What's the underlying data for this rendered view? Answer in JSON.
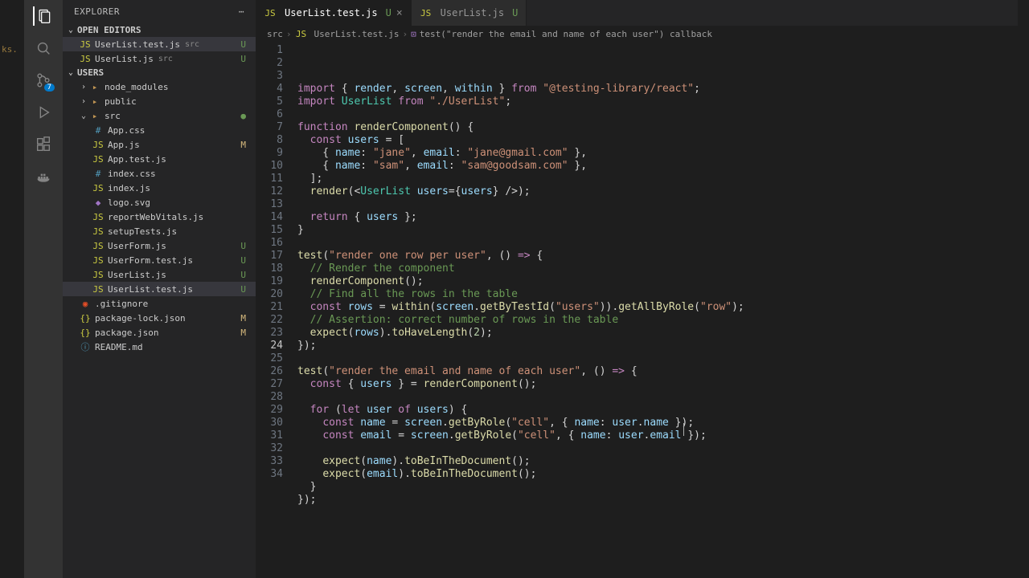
{
  "leftStrip": "ks.",
  "sidebar": {
    "title": "EXPLORER",
    "sections": {
      "openEditors": "OPEN EDITORS",
      "workspace": "USERS"
    },
    "openEditorItems": [
      {
        "name": "UserList.test.js",
        "dir": "src",
        "badge": "U"
      },
      {
        "name": "UserList.js",
        "dir": "src",
        "badge": "U"
      }
    ],
    "tree": [
      {
        "type": "folder",
        "name": "node_modules",
        "indent": 1,
        "chev": "›"
      },
      {
        "type": "folder",
        "name": "public",
        "indent": 1,
        "chev": "›"
      },
      {
        "type": "folder",
        "name": "src",
        "indent": 1,
        "chev": "⌄",
        "dot": true
      },
      {
        "type": "file",
        "name": "App.css",
        "indent": 2,
        "ico": "ico-css",
        "glyph": "#"
      },
      {
        "type": "file",
        "name": "App.js",
        "indent": 2,
        "ico": "ico-js",
        "glyph": "JS",
        "badge": "M"
      },
      {
        "type": "file",
        "name": "App.test.js",
        "indent": 2,
        "ico": "ico-js",
        "glyph": "JS"
      },
      {
        "type": "file",
        "name": "index.css",
        "indent": 2,
        "ico": "ico-css",
        "glyph": "#"
      },
      {
        "type": "file",
        "name": "index.js",
        "indent": 2,
        "ico": "ico-js",
        "glyph": "JS"
      },
      {
        "type": "file",
        "name": "logo.svg",
        "indent": 2,
        "ico": "ico-svg",
        "glyph": "◆"
      },
      {
        "type": "file",
        "name": "reportWebVitals.js",
        "indent": 2,
        "ico": "ico-js",
        "glyph": "JS"
      },
      {
        "type": "file",
        "name": "setupTests.js",
        "indent": 2,
        "ico": "ico-js",
        "glyph": "JS"
      },
      {
        "type": "file",
        "name": "UserForm.js",
        "indent": 2,
        "ico": "ico-js",
        "glyph": "JS",
        "badge": "U"
      },
      {
        "type": "file",
        "name": "UserForm.test.js",
        "indent": 2,
        "ico": "ico-js",
        "glyph": "JS",
        "badge": "U"
      },
      {
        "type": "file",
        "name": "UserList.js",
        "indent": 2,
        "ico": "ico-js",
        "glyph": "JS",
        "badge": "U"
      },
      {
        "type": "file",
        "name": "UserList.test.js",
        "indent": 2,
        "ico": "ico-js",
        "glyph": "JS",
        "badge": "U",
        "active": true
      },
      {
        "type": "file",
        "name": ".gitignore",
        "indent": 1,
        "ico": "ico-git",
        "glyph": "◉"
      },
      {
        "type": "file",
        "name": "package-lock.json",
        "indent": 1,
        "ico": "ico-json",
        "glyph": "{}",
        "badge": "M"
      },
      {
        "type": "file",
        "name": "package.json",
        "indent": 1,
        "ico": "ico-json",
        "glyph": "{}",
        "badge": "M"
      },
      {
        "type": "file",
        "name": "README.md",
        "indent": 1,
        "ico": "ico-md",
        "glyph": "ⓘ"
      }
    ]
  },
  "tabs": [
    {
      "name": "UserList.test.js",
      "status": "U",
      "active": true
    },
    {
      "name": "UserList.js",
      "status": "U",
      "active": false
    }
  ],
  "breadcrumb": {
    "parts": [
      "src",
      "UserList.test.js",
      "test(\"render the email and name of each user\") callback"
    ]
  },
  "currentLine": 24,
  "code": [
    {
      "n": 1,
      "h": "<span class='kw'>import</span> { <span class='var'>render</span>, <span class='var'>screen</span>, <span class='var'>within</span> } <span class='kw'>from</span> <span class='str'>\"@testing-library/react\"</span>;"
    },
    {
      "n": 2,
      "h": "<span class='kw'>import</span> <span class='cls'>UserList</span> <span class='kw'>from</span> <span class='str'>\"./UserList\"</span>;"
    },
    {
      "n": 3,
      "h": ""
    },
    {
      "n": 4,
      "h": "<span class='kw'>function</span> <span class='fn'>renderComponent</span>() {"
    },
    {
      "n": 5,
      "h": "  <span class='kw'>const</span> <span class='var'>users</span> = ["
    },
    {
      "n": 6,
      "h": "    { <span class='var'>name</span>: <span class='str'>\"jane\"</span>, <span class='var'>email</span>: <span class='str'>\"jane@gmail.com\"</span> },"
    },
    {
      "n": 7,
      "h": "    { <span class='var'>name</span>: <span class='str'>\"sam\"</span>, <span class='var'>email</span>: <span class='str'>\"sam@goodsam.com\"</span> },"
    },
    {
      "n": 8,
      "h": "  ];"
    },
    {
      "n": 9,
      "h": "  <span class='fn'>render</span>(&lt;<span class='cls'>UserList</span> <span class='var'>users</span>={<span class='var'>users</span>} /&gt;);"
    },
    {
      "n": 10,
      "h": ""
    },
    {
      "n": 11,
      "h": "  <span class='kw'>return</span> { <span class='var'>users</span> };"
    },
    {
      "n": 12,
      "h": "}"
    },
    {
      "n": 13,
      "h": ""
    },
    {
      "n": 14,
      "h": "<span class='fn'>test</span>(<span class='str'>\"render one row per user\"</span>, () <span class='kw'>=&gt;</span> {"
    },
    {
      "n": 15,
      "h": "  <span class='cmt'>// Render the component</span>"
    },
    {
      "n": 16,
      "h": "  <span class='fn'>renderComponent</span>();"
    },
    {
      "n": 17,
      "h": "  <span class='cmt'>// Find all the rows in the table</span>"
    },
    {
      "n": 18,
      "h": "  <span class='kw'>const</span> <span class='var'>rows</span> = <span class='fn'>within</span>(<span class='var'>screen</span>.<span class='fn'>getByTestId</span>(<span class='str'>\"users\"</span>)).<span class='fn'>getAllByRole</span>(<span class='str'>\"row\"</span>);"
    },
    {
      "n": 19,
      "h": "  <span class='cmt'>// Assertion: correct number of rows in the table</span>"
    },
    {
      "n": 20,
      "h": "  <span class='fn'>expect</span>(<span class='var'>rows</span>).<span class='fn'>toHaveLength</span>(<span class='num'>2</span>);"
    },
    {
      "n": 21,
      "h": "});"
    },
    {
      "n": 22,
      "h": ""
    },
    {
      "n": 23,
      "h": "<span class='fn'>test</span>(<span class='str'>\"render the email and name of each user\"</span>, () <span class='kw'>=&gt;</span> {"
    },
    {
      "n": 24,
      "h": "  <span class='kw'>const</span> { <span class='var'>users</span> } = <span class='fn'>renderComponent</span>();"
    },
    {
      "n": 25,
      "h": ""
    },
    {
      "n": 26,
      "h": "  <span class='kw'>for</span> (<span class='kw'>let</span> <span class='var'>user</span> <span class='kw'>of</span> <span class='var'>users</span>) {"
    },
    {
      "n": 27,
      "h": "    <span class='kw'>const</span> <span class='var'>name</span> = <span class='var'>screen</span>.<span class='fn'>getByRole</span>(<span class='str'>\"cell\"</span>, { <span class='var'>name</span>: <span class='var'>user</span>.<span class='var'>name</span> });"
    },
    {
      "n": 28,
      "h": "    <span class='kw'>const</span> <span class='var'>email</span> = <span class='var'>screen</span>.<span class='fn'>getByRole</span>(<span class='str'>\"cell\"</span>, { <span class='var'>name</span>: <span class='var'>user</span>.<span class='var'>email</span> });"
    },
    {
      "n": 29,
      "h": ""
    },
    {
      "n": 30,
      "h": "    <span class='fn'>expect</span>(<span class='var'>name</span>).<span class='fn'>toBeInTheDocument</span>();"
    },
    {
      "n": 31,
      "h": "    <span class='fn'>expect</span>(<span class='var'>email</span>).<span class='fn'>toBeInTheDocument</span>();"
    },
    {
      "n": 32,
      "h": "  }"
    },
    {
      "n": 33,
      "h": "});"
    },
    {
      "n": 34,
      "h": ""
    }
  ]
}
